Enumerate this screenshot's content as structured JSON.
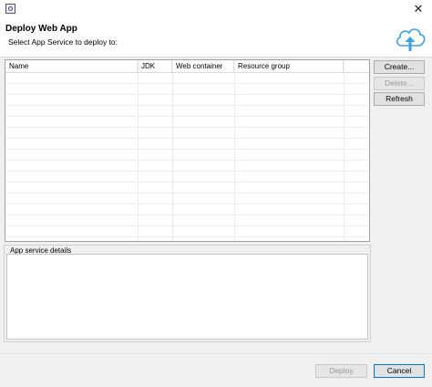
{
  "window": {
    "close_glyph": "✕"
  },
  "header": {
    "title": "Deploy Web App",
    "subtitle": "Select App Service to deploy to:",
    "icon": "cloud-upload-icon"
  },
  "table": {
    "columns": [
      "Name",
      "JDK",
      "Web container",
      "Resource group"
    ],
    "rows": []
  },
  "buttons": {
    "create": "Create...",
    "delete": "Delete...",
    "refresh": "Refresh",
    "deploy": "Deploy",
    "cancel": "Cancel"
  },
  "details": {
    "label": "App service details"
  },
  "colors": {
    "accent": "#0078d7",
    "cloud": "#3aa0e0"
  }
}
